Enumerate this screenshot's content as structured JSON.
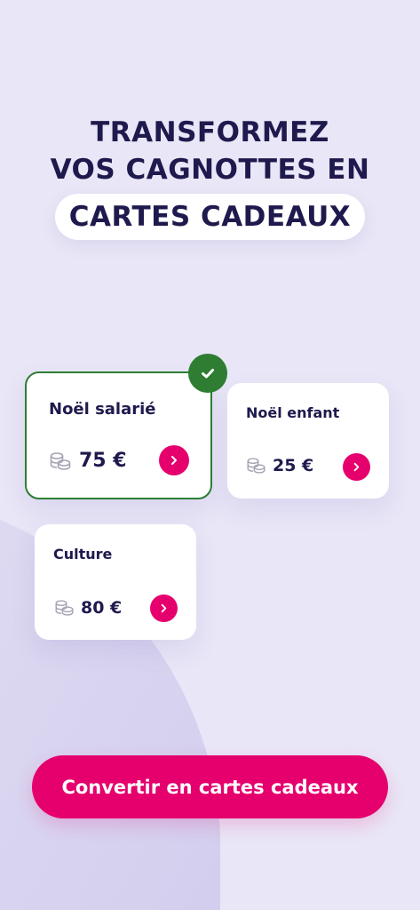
{
  "headline": {
    "line1": "TRANSFORMEZ",
    "line2": "VOS CAGNOTTES EN",
    "highlight": "CARTES CADEAUX"
  },
  "cards": [
    {
      "title": "Noël salarié",
      "amount": "75 €",
      "selected": true
    },
    {
      "title": "Noël enfant",
      "amount": "25 €",
      "selected": false
    },
    {
      "title": "Culture",
      "amount": "80 €",
      "selected": false
    }
  ],
  "icons": {
    "coin": "coins-icon",
    "arrow": "chevron-right-icon",
    "check": "check-icon"
  },
  "colors": {
    "background": "#e9e6f7",
    "text": "#1e1a4d",
    "accent": "#e5006d",
    "selected": "#2e7d32"
  },
  "cta": {
    "label": "Convertir en cartes cadeaux"
  }
}
